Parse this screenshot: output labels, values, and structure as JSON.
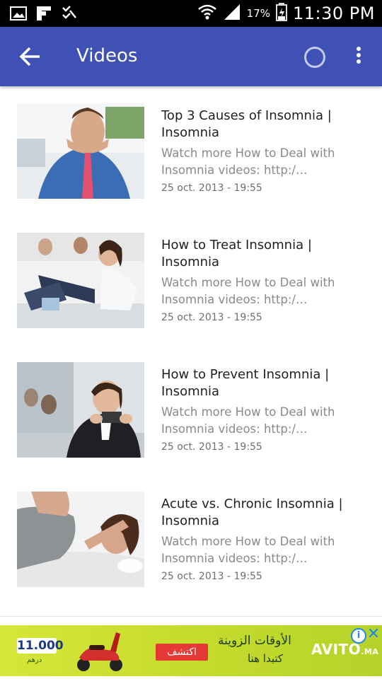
{
  "status_bar": {
    "icons_left": [
      "image-icon",
      "flipboard-icon",
      "checklist-icon"
    ],
    "battery_percent": "17%",
    "time": "11:30 PM"
  },
  "app_bar": {
    "title": "Videos",
    "color": "#3f51b5"
  },
  "videos": [
    {
      "title": "Top 3 Causes of Insomnia | Insomnia",
      "description": "Watch more How to Deal with Insomnia videos: http:/…",
      "date": "25 oct. 2013 - 19:55",
      "thumbnail": "stressed-man-thumbnail"
    },
    {
      "title": "How to Treat Insomnia | Insomnia",
      "description": "Watch more How to Deal with Insomnia videos: http:/…",
      "date": "25 oct. 2013 - 19:55",
      "thumbnail": "stretching-class-thumbnail"
    },
    {
      "title": "How to Prevent Insomnia | Insomnia",
      "description": "Watch more How to Deal with Insomnia videos: http:/…",
      "date": "25 oct. 2013 - 19:55",
      "thumbnail": "woman-with-coffee-thumbnail"
    },
    {
      "title": "Acute vs. Chronic Insomnia | Insomnia",
      "description": "Watch more How to Deal with Insomnia videos: http:/…",
      "date": "25 oct. 2013 - 19:55",
      "thumbnail": "woman-in-bed-thumbnail"
    }
  ],
  "ad": {
    "price": "11.000",
    "currency": "درهم",
    "cta": "اكتشف",
    "headline": "الأوقات الزوينة",
    "subline": "كتبدا هنا",
    "brand": "AVITO",
    "brand_suffix": ".MA"
  }
}
